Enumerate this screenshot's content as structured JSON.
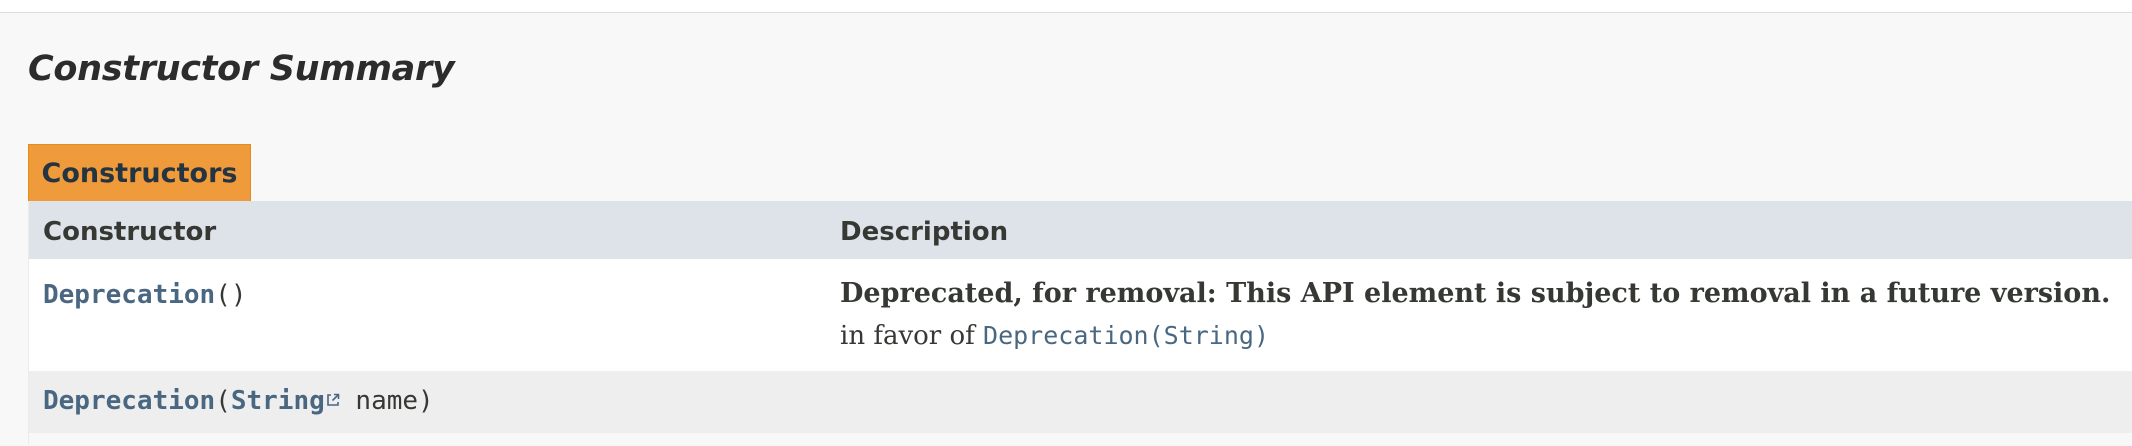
{
  "section": {
    "title": "Constructor Summary",
    "tab_label": "Constructors",
    "columns": {
      "constructor": "Constructor",
      "description": "Description"
    }
  },
  "rows": [
    {
      "name": "Deprecation",
      "params": "()",
      "deprecated_label": "Deprecated, for removal: This API element is subject to removal in a future version.",
      "favor_prefix": "in favor of",
      "favor_link": "Deprecation(String)"
    },
    {
      "name": "Deprecation",
      "open_paren": "(",
      "param_type": "String",
      "param_rest": " name)"
    }
  ],
  "colors": {
    "tab": "#f09b3b",
    "header_row": "#dee3e9",
    "link": "#4a6782",
    "alt_row": "#eeeeef"
  },
  "icons": {
    "external_link": "external-link-icon"
  }
}
